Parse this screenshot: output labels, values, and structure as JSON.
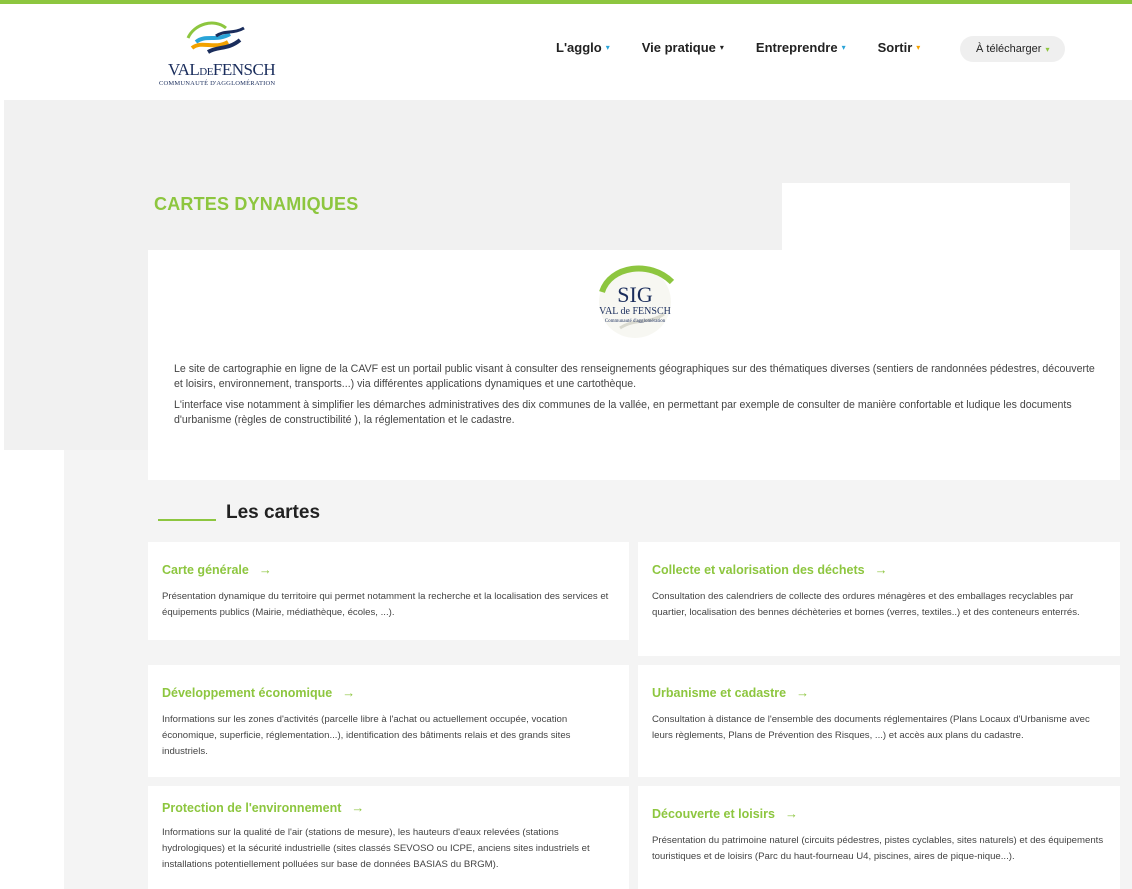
{
  "header": {
    "logo_main": "VAL",
    "logo_de": "DE",
    "logo_name": "FENSCH",
    "logo_sub": "COMMUNAUTÉ D'AGGLOMÉRATION",
    "nav": [
      {
        "label": "L'agglo",
        "caret": "blue"
      },
      {
        "label": "Vie pratique",
        "caret": "dark"
      },
      {
        "label": "Entreprendre",
        "caret": "blue"
      },
      {
        "label": "Sortir",
        "caret": "orange"
      }
    ],
    "download_label": "À télécharger",
    "colors": {
      "accent": "#8dc63f",
      "blue": "#2aa4d8",
      "orange": "#f2a100",
      "navy": "#1a2d5c"
    }
  },
  "page": {
    "title": "CARTES DYNAMIQUES"
  },
  "sig_logo": {
    "big": "SIG",
    "line2": "VAL de FENSCH",
    "line3": "Communauté d'agglomération"
  },
  "intro": {
    "p1": "Le site de cartographie en ligne de la CAVF est un portail public visant à consulter des renseignements géographiques sur des thématiques diverses (sentiers de randonnées pédestres, découverte et loisirs, environnement, transports...) via différentes applications dynamiques et une cartothèque.",
    "p2": "L'interface vise notamment à simplifier les démarches administratives des dix communes de la vallée, en permettant par exemple de consulter de manière confortable et ludique les documents d'urbanisme (règles de constructibilité ), la réglementation et le cadastre."
  },
  "section": {
    "title": "Les cartes"
  },
  "cards": [
    {
      "title": "Carte générale",
      "desc": "Présentation dynamique du territoire qui permet notamment la recherche et la localisation des services et équipements publics (Mairie, médiathèque, écoles, ...)."
    },
    {
      "title": "Collecte et valorisation des déchets",
      "desc": "Consultation des calendriers de collecte des ordures ménagères et des emballages recyclables par quartier, localisation des bennes déchèteries et bornes (verres, textiles..) et des conteneurs enterrés."
    },
    {
      "title": "Développement économique",
      "desc": "Informations sur les zones d'activités (parcelle libre à l'achat ou actuellement occupée, vocation économique, superficie, réglementation...), identification des bâtiments relais et des grands sites industriels."
    },
    {
      "title": "Urbanisme et cadastre",
      "desc": "Consultation à distance de l'ensemble des documents réglementaires (Plans Locaux d'Urbanisme avec leurs règlements, Plans de Prévention des Risques, ...) et accès aux plans du cadastre."
    },
    {
      "title": "Protection de l'environnement",
      "desc": "Informations sur la qualité de l'air (stations de mesure), les hauteurs d'eaux relevées (stations hydrologiques) et la sécurité industrielle (sites classés SEVOSO ou ICPE, anciens sites industriels et installations potentiellement polluées sur base de données BASIAS du BRGM)."
    },
    {
      "title": "Découverte et loisirs",
      "desc": "Présentation du patrimoine naturel (circuits pédestres, pistes cyclables, sites naturels) et des équipements touristiques et de loisirs (Parc du haut-fourneau U4, piscines, aires de pique-nique...)."
    }
  ],
  "icons": {
    "arrow": "→",
    "caret": "▾"
  }
}
